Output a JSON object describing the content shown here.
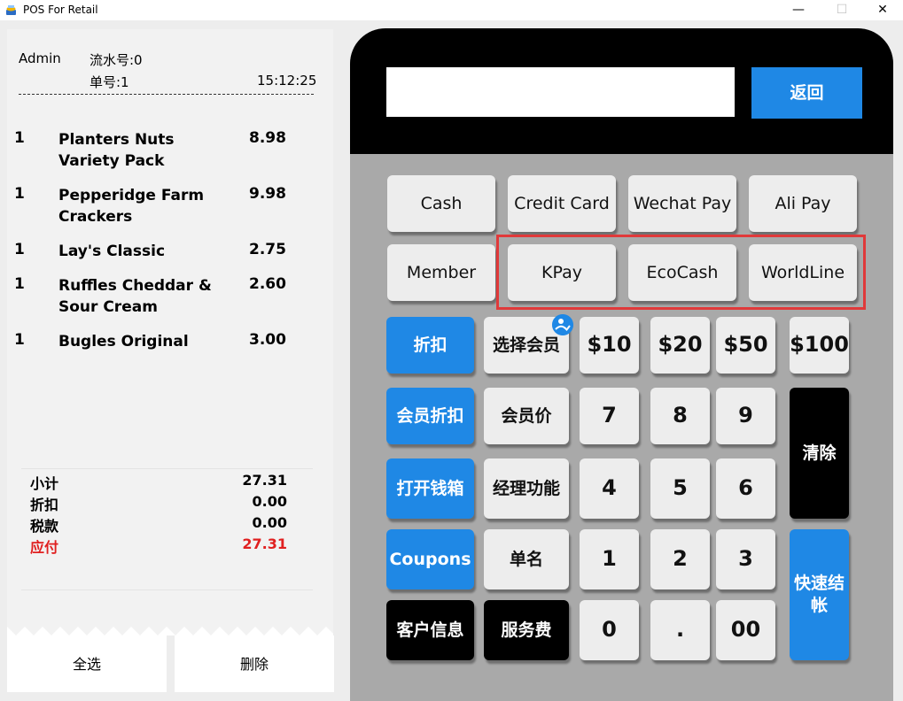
{
  "window": {
    "title": "POS For Retail",
    "minimize": "—",
    "maximize": "☐",
    "close": "✕"
  },
  "receipt": {
    "user": "Admin",
    "serial": "流水号:0",
    "order": "单号:1",
    "time": "15:12:25",
    "items": [
      {
        "qty": "1",
        "name": "Planters Nuts Variety Pack",
        "price": "8.98"
      },
      {
        "qty": "1",
        "name": "Pepperidge Farm Crackers",
        "price": "9.98"
      },
      {
        "qty": "1",
        "name": "Lay's Classic",
        "price": "2.75"
      },
      {
        "qty": "1",
        "name": "Ruffles Cheddar & Sour Cream",
        "price": "2.60"
      },
      {
        "qty": "1",
        "name": "Bugles Original",
        "price": "3.00"
      }
    ],
    "totals": {
      "subtotal_label": "小计",
      "subtotal": "27.31",
      "discount_label": "折扣",
      "discount": "0.00",
      "tax_label": "税款",
      "tax": "0.00",
      "due_label": "应付",
      "due": "27.31"
    },
    "select_all": "全选",
    "delete": "删除"
  },
  "keypad": {
    "display_value": "",
    "back": "返回",
    "payments": [
      "Cash",
      "Credit Card",
      "Wechat Pay",
      "Ali Pay",
      "Member",
      "KPay",
      "EcoCash",
      "WorldLine"
    ],
    "discount": "折扣",
    "member_discount": "会员折扣",
    "open_drawer": "打开钱箱",
    "coupons": "Coupons",
    "customer_info": "客户信息",
    "select_member": "选择会员",
    "member_price": "会员价",
    "manager": "经理功能",
    "hold_order": "单名",
    "service_fee": "服务费",
    "quick_amounts": [
      "$10",
      "$20",
      "$50",
      "$100"
    ],
    "digits": [
      "7",
      "8",
      "9",
      "4",
      "5",
      "6",
      "1",
      "2",
      "3",
      "0",
      ".",
      "00"
    ],
    "clear": "清除",
    "quick_checkout": "快速结帐"
  },
  "colors": {
    "accent_blue": "#1f88e5",
    "due_red": "#e02020",
    "highlight_box": "#e0393a"
  },
  "icons": {
    "app": "pos-app-icon",
    "member_badge": "user-check-icon"
  }
}
